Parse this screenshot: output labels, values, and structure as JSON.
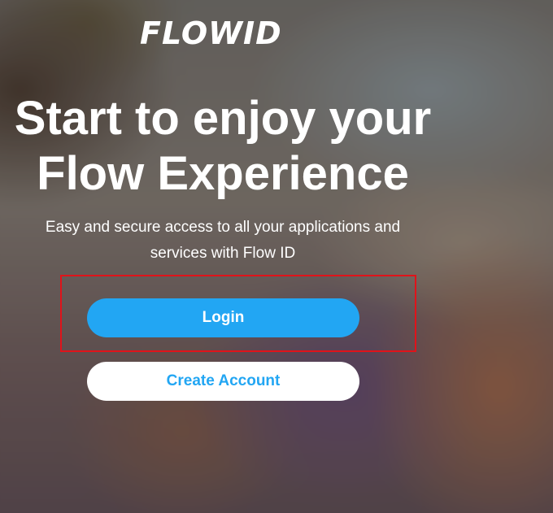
{
  "brand": {
    "logo_text": "FLOWID"
  },
  "hero": {
    "headline_line1": "Start to enjoy your",
    "headline_line2": "Flow Experience",
    "subtitle_line1": "Easy and secure access to all your applications and",
    "subtitle_line2": "services with Flow ID"
  },
  "actions": {
    "login_label": "Login",
    "create_account_label": "Create Account"
  },
  "colors": {
    "accent": "#22a6f3",
    "highlight_border": "#e0131a",
    "text_on_dark": "#ffffff"
  }
}
